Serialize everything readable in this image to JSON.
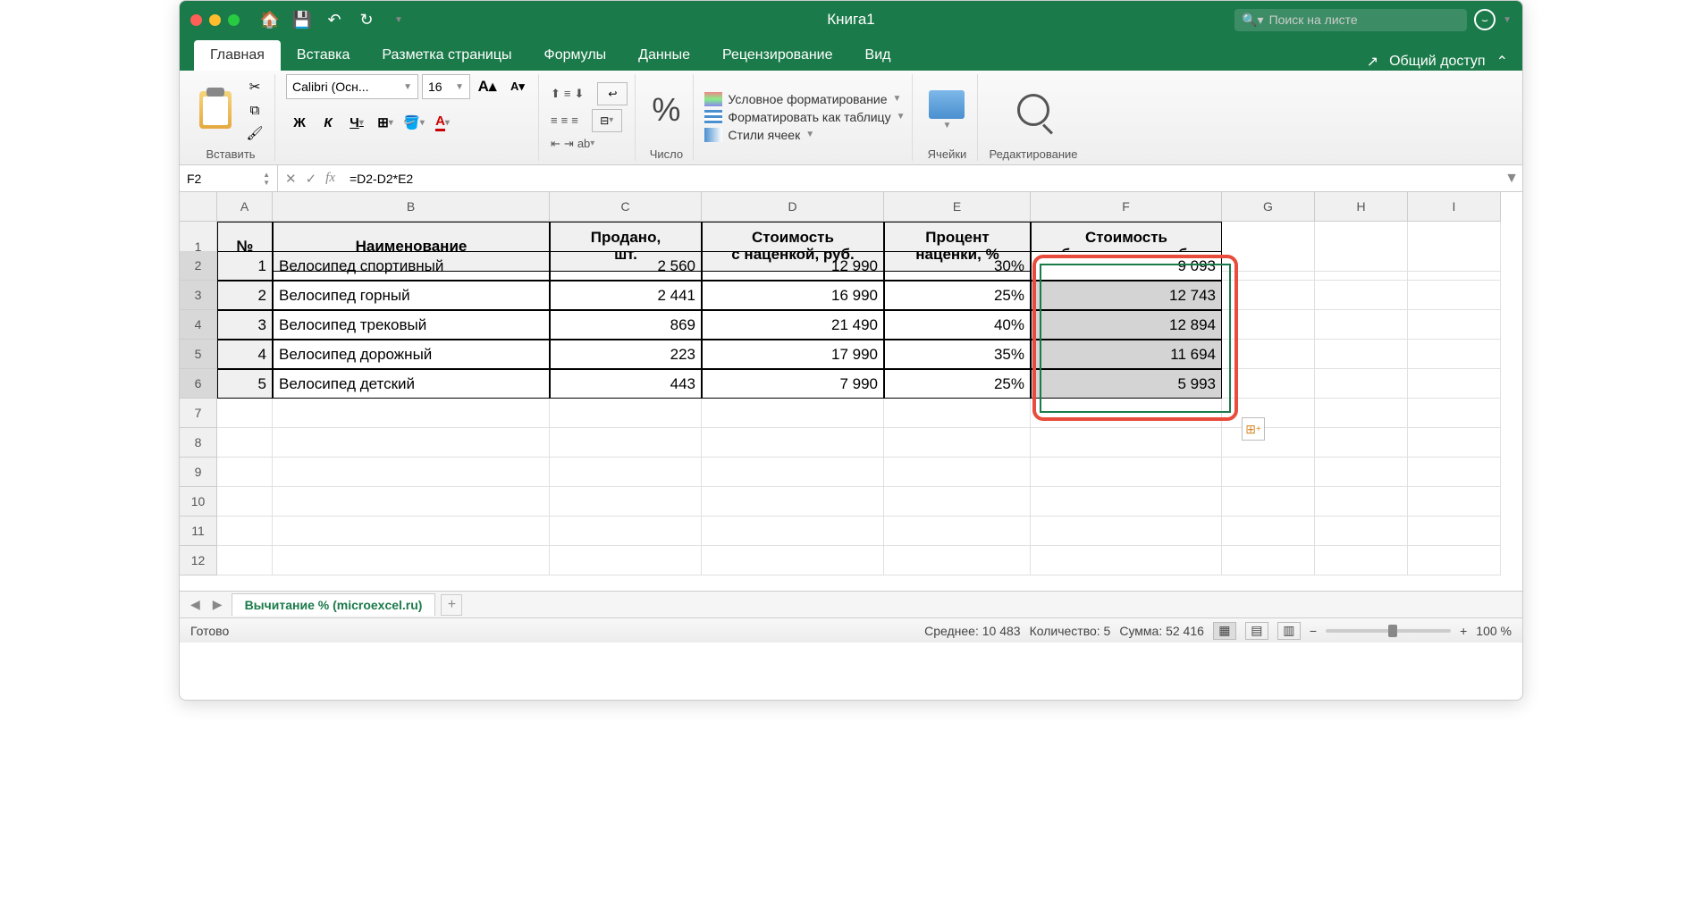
{
  "title": "Книга1",
  "search_placeholder": "Поиск на листе",
  "tabs": [
    "Главная",
    "Вставка",
    "Разметка страницы",
    "Формулы",
    "Данные",
    "Рецензирование",
    "Вид"
  ],
  "share": "Общий доступ",
  "ribbon": {
    "paste": "Вставить",
    "font_name": "Calibri (Осн...",
    "font_size": "16",
    "bold": "Ж",
    "italic": "К",
    "underline": "Ч",
    "number": "Число",
    "cond_fmt": "Условное форматирование",
    "fmt_table": "Форматировать как таблицу",
    "cell_styles": "Стили ячеек",
    "cells": "Ячейки",
    "editing": "Редактирование"
  },
  "name_box": "F2",
  "formula": "=D2-D2*E2",
  "columns": [
    "A",
    "B",
    "C",
    "D",
    "E",
    "F",
    "G",
    "H",
    "I"
  ],
  "rows": [
    "1",
    "2",
    "3",
    "4",
    "5",
    "6",
    "7",
    "8",
    "9",
    "10",
    "11",
    "12"
  ],
  "headers": {
    "a": "№",
    "b": "Наименование",
    "c": "Продано,\nшт.",
    "d": "Стоимость\nс наценкой, руб.",
    "e": "Процент\nнаценки, %",
    "f": "Стоимость\nбез наценки, руб."
  },
  "data": [
    {
      "n": "1",
      "name": "Велосипед спортивный",
      "sold": "2 560",
      "price": "12 990",
      "pct": "30%",
      "noprice": "9 093"
    },
    {
      "n": "2",
      "name": "Велосипед горный",
      "sold": "2 441",
      "price": "16 990",
      "pct": "25%",
      "noprice": "12 743"
    },
    {
      "n": "3",
      "name": "Велосипед трековый",
      "sold": "869",
      "price": "21 490",
      "pct": "40%",
      "noprice": "12 894"
    },
    {
      "n": "4",
      "name": "Велосипед дорожный",
      "sold": "223",
      "price": "17 990",
      "pct": "35%",
      "noprice": "11 694"
    },
    {
      "n": "5",
      "name": "Велосипед детский",
      "sold": "443",
      "price": "7 990",
      "pct": "25%",
      "noprice": "5 993"
    }
  ],
  "sheet_tab": "Вычитание % (microexcel.ru)",
  "status": {
    "ready": "Готово",
    "avg": "Среднее: 10 483",
    "count": "Количество: 5",
    "sum": "Сумма: 52 416",
    "zoom": "100 %"
  }
}
